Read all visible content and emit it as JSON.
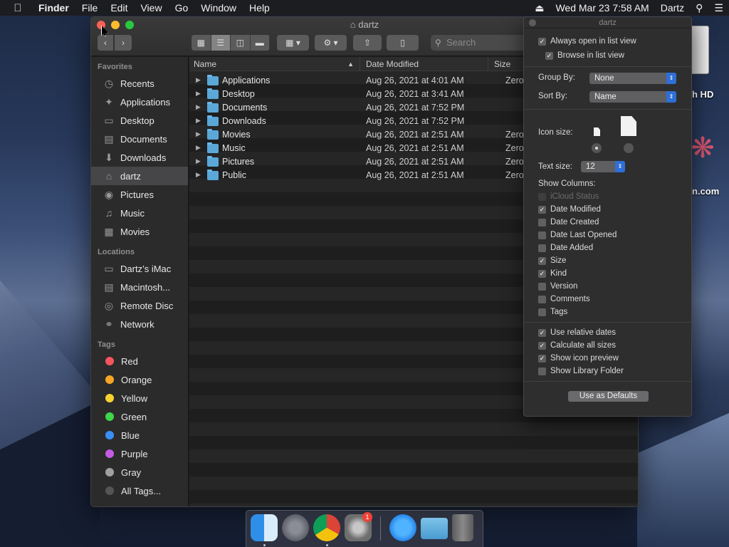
{
  "menubar": {
    "app": "Finder",
    "items": [
      "File",
      "Edit",
      "View",
      "Go",
      "Window",
      "Help"
    ],
    "clock": "Wed Mar 23  7:58 AM",
    "user": "Dartz"
  },
  "desktop": {
    "disk_label": "h HD",
    "app_label": "n.com"
  },
  "window": {
    "title": "dartz",
    "search_placeholder": "Search"
  },
  "sidebar": {
    "favorites_header": "Favorites",
    "favorites": [
      {
        "label": "Recents",
        "icon": "clock-icon"
      },
      {
        "label": "Applications",
        "icon": "applications-icon"
      },
      {
        "label": "Desktop",
        "icon": "desktop-icon"
      },
      {
        "label": "Documents",
        "icon": "document-icon"
      },
      {
        "label": "Downloads",
        "icon": "download-icon"
      },
      {
        "label": "dartz",
        "icon": "home-icon"
      },
      {
        "label": "Pictures",
        "icon": "camera-icon"
      },
      {
        "label": "Music",
        "icon": "music-note-icon"
      },
      {
        "label": "Movies",
        "icon": "film-icon"
      }
    ],
    "locations_header": "Locations",
    "locations": [
      {
        "label": "Dartz’s iMac",
        "icon": "imac-icon"
      },
      {
        "label": "Macintosh...",
        "icon": "hard-disk-icon"
      },
      {
        "label": "Remote Disc",
        "icon": "disc-icon"
      },
      {
        "label": "Network",
        "icon": "globe-icon"
      }
    ],
    "tags_header": "Tags",
    "tags": [
      {
        "label": "Red",
        "color": "#f5555c"
      },
      {
        "label": "Orange",
        "color": "#f6a623"
      },
      {
        "label": "Yellow",
        "color": "#f8d230"
      },
      {
        "label": "Green",
        "color": "#3ed54a"
      },
      {
        "label": "Blue",
        "color": "#3a8ff5"
      },
      {
        "label": "Purple",
        "color": "#c35ce3"
      },
      {
        "label": "Gray",
        "color": "#a0a0a0"
      },
      {
        "label": "All Tags...",
        "color": "#555555"
      }
    ]
  },
  "list": {
    "columns": [
      "Name",
      "Date Modified",
      "Size"
    ],
    "rows": [
      {
        "name": "Applications",
        "date": "Aug 26, 2021 at 4:01 AM",
        "size": "Zero"
      },
      {
        "name": "Desktop",
        "date": "Aug 26, 2021 at 3:41 AM",
        "size": ""
      },
      {
        "name": "Documents",
        "date": "Aug 26, 2021 at 7:52 PM",
        "size": ""
      },
      {
        "name": "Downloads",
        "date": "Aug 26, 2021 at 7:52 PM",
        "size": ""
      },
      {
        "name": "Movies",
        "date": "Aug 26, 2021 at 2:51 AM",
        "size": "Zero"
      },
      {
        "name": "Music",
        "date": "Aug 26, 2021 at 2:51 AM",
        "size": "Zero"
      },
      {
        "name": "Pictures",
        "date": "Aug 26, 2021 at 2:51 AM",
        "size": "Zero"
      },
      {
        "name": "Public",
        "date": "Aug 26, 2021 at 2:51 AM",
        "size": "Zero"
      }
    ]
  },
  "viewopts": {
    "title": "dartz",
    "always_open": "Always open in list view",
    "browse": "Browse in list view",
    "group_by_label": "Group By:",
    "group_by_value": "None",
    "sort_by_label": "Sort By:",
    "sort_by_value": "Name",
    "icon_size_label": "Icon size:",
    "text_size_label": "Text size:",
    "text_size_value": "12",
    "show_columns_label": "Show Columns:",
    "columns": [
      {
        "label": "iCloud Status",
        "checked": false,
        "disabled": true
      },
      {
        "label": "Date Modified",
        "checked": true
      },
      {
        "label": "Date Created",
        "checked": false
      },
      {
        "label": "Date Last Opened",
        "checked": false
      },
      {
        "label": "Date Added",
        "checked": false
      },
      {
        "label": "Size",
        "checked": true
      },
      {
        "label": "Kind",
        "checked": true
      },
      {
        "label": "Version",
        "checked": false
      },
      {
        "label": "Comments",
        "checked": false
      },
      {
        "label": "Tags",
        "checked": false
      }
    ],
    "options": [
      {
        "label": "Use relative dates",
        "checked": true
      },
      {
        "label": "Calculate all sizes",
        "checked": true
      },
      {
        "label": "Show icon preview",
        "checked": true
      },
      {
        "label": "Show Library Folder",
        "checked": false
      }
    ],
    "defaults_button": "Use as Defaults"
  },
  "dock": {
    "badge": "1"
  }
}
